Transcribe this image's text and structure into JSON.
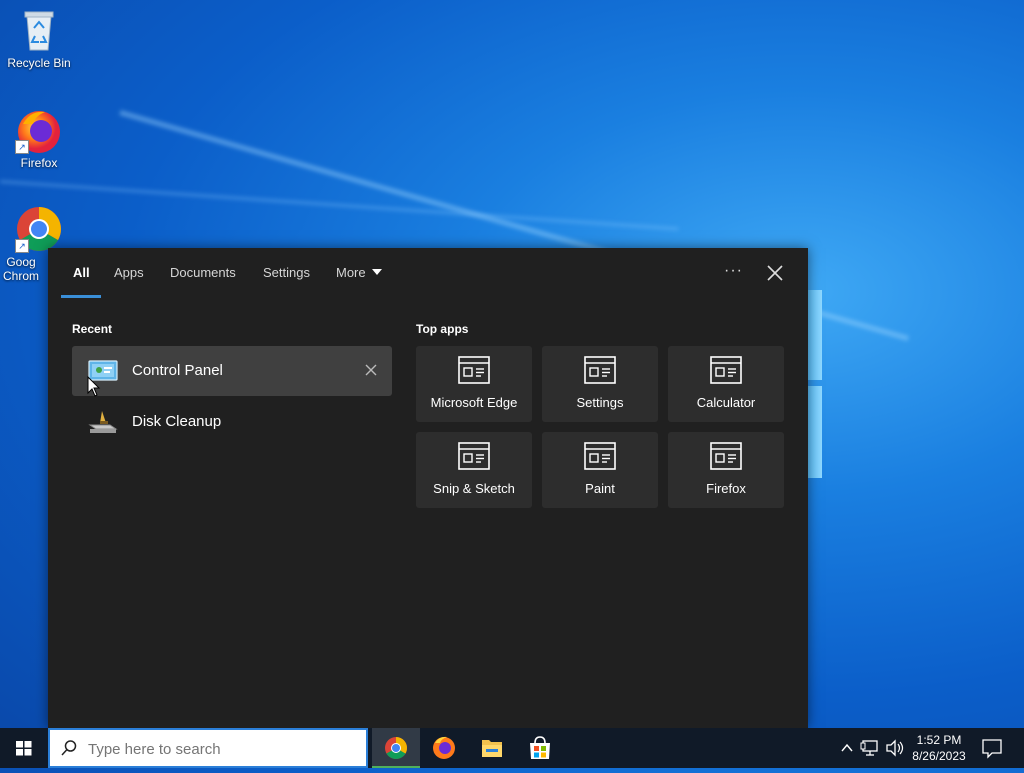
{
  "desktop": {
    "icons": [
      {
        "label": "Recycle Bin"
      },
      {
        "label": "Firefox"
      },
      {
        "label": "Google Chrome",
        "visible_label": "Goog Chrom"
      }
    ]
  },
  "search_panel": {
    "tabs": [
      {
        "label": "All",
        "active": true
      },
      {
        "label": "Apps"
      },
      {
        "label": "Documents"
      },
      {
        "label": "Settings"
      },
      {
        "label": "More"
      }
    ],
    "more_options_label": "···",
    "recent": {
      "title": "Recent",
      "items": [
        {
          "label": "Control Panel",
          "icon": "control-panel-icon",
          "hovered": true
        },
        {
          "label": "Disk Cleanup",
          "icon": "disk-cleanup-icon"
        }
      ]
    },
    "top_apps": {
      "title": "Top apps",
      "items": [
        {
          "label": "Microsoft Edge"
        },
        {
          "label": "Settings"
        },
        {
          "label": "Calculator"
        },
        {
          "label": "Snip & Sketch"
        },
        {
          "label": "Paint"
        },
        {
          "label": "Firefox"
        }
      ]
    }
  },
  "taskbar": {
    "search_placeholder": "Type here to search",
    "pinned": [
      "Google Chrome",
      "Firefox",
      "File Explorer",
      "Microsoft Store"
    ],
    "clock": {
      "time": "1:52 PM",
      "date": "8/26/2023"
    }
  },
  "colors": {
    "accent": "#3a8fd8",
    "panel_bg": "#202020",
    "tile_bg": "#2d2d2d",
    "hover_bg": "#404040",
    "taskbar_bg": "#101a28"
  }
}
